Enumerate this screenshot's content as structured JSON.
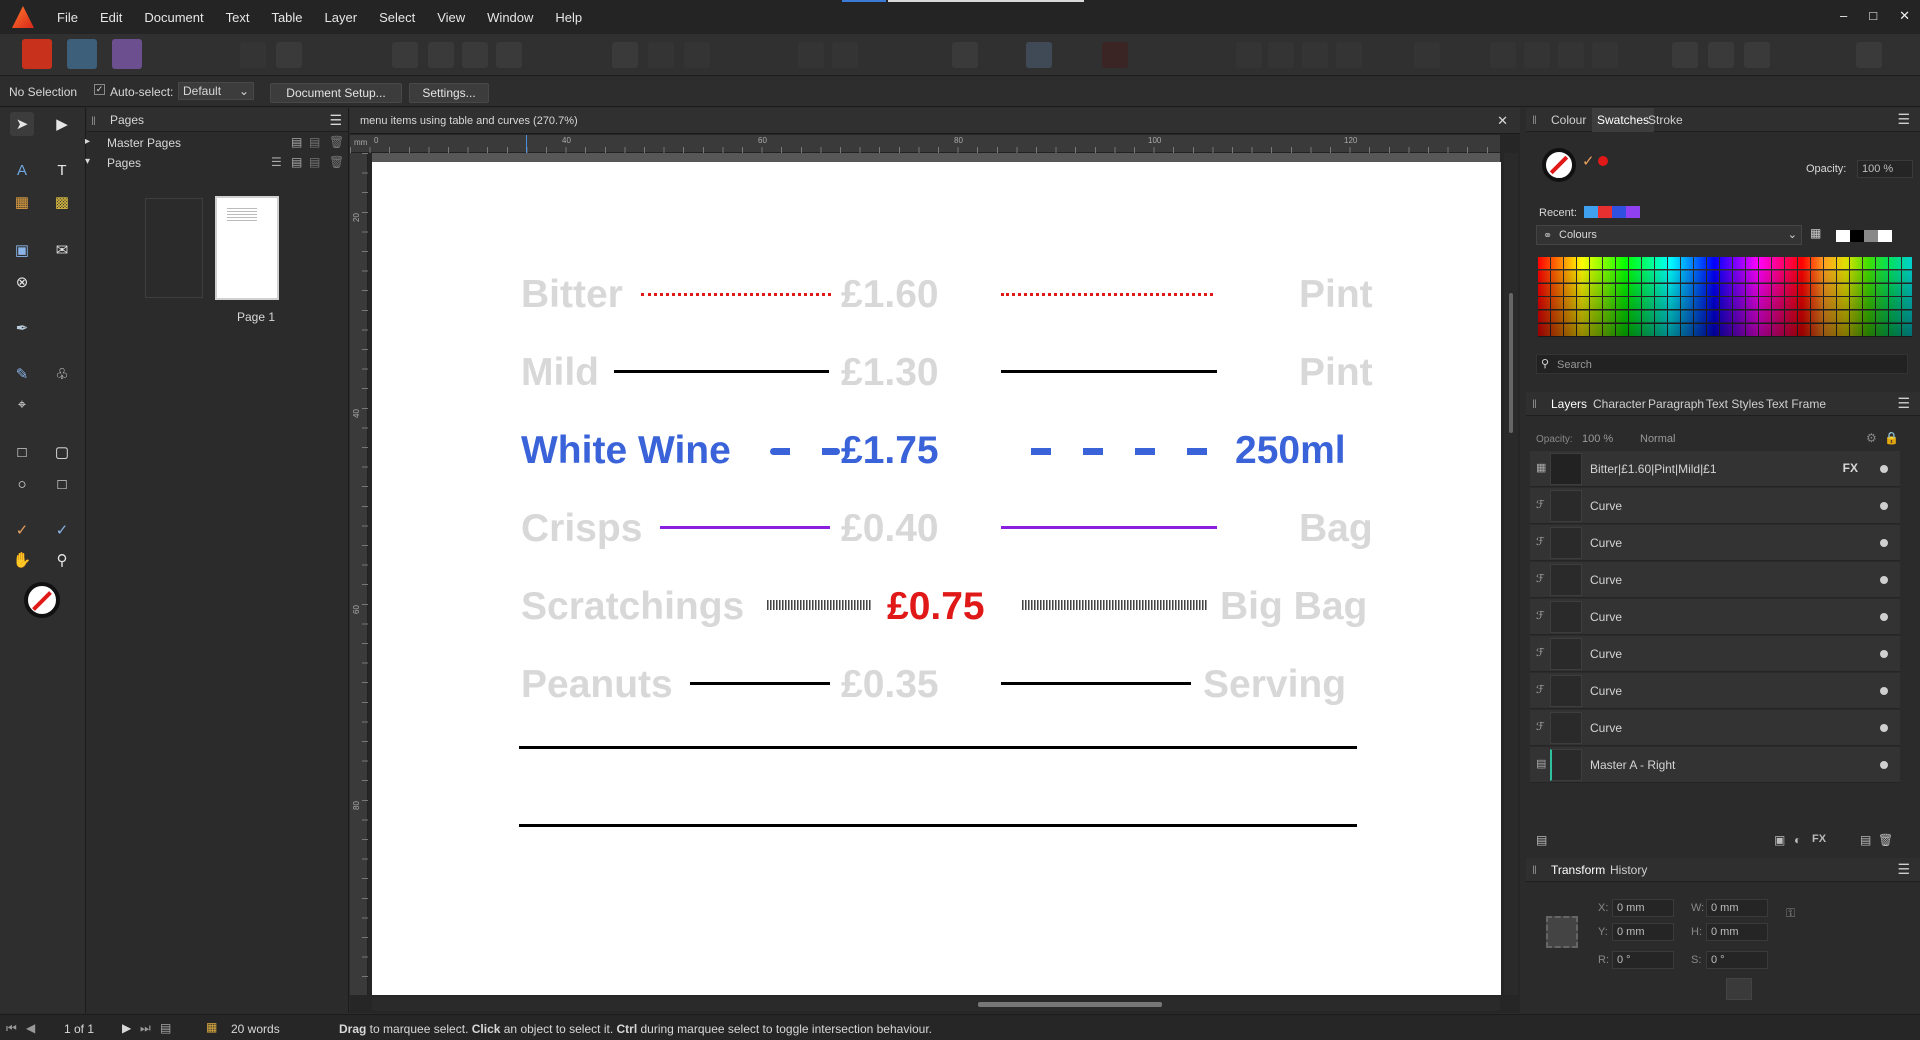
{
  "menu": [
    "File",
    "Edit",
    "Document",
    "Text",
    "Table",
    "Layer",
    "Select",
    "View",
    "Window",
    "Help"
  ],
  "window_buttons": [
    "–",
    "□",
    "✕"
  ],
  "context": {
    "selection": "No Selection",
    "autoselect_label": "Auto-select:",
    "autoselect_value": "Default",
    "doc_setup": "Document Setup...",
    "settings": "Settings..."
  },
  "pages_panel": {
    "title": "Pages",
    "master_pages": "Master Pages",
    "pages": "Pages",
    "page_label": "Page 1"
  },
  "document": {
    "tab_title": "menu items using table and curves (270.7%)",
    "ruler_unit": "mm",
    "ruler_ticks": [
      "0",
      "40",
      "60",
      "80",
      "100",
      "120"
    ],
    "vruler_ticks": [
      "20",
      "40",
      "60",
      "80"
    ],
    "menu_items": [
      {
        "item": "Bitter",
        "price": "£1.60",
        "unit": "Pint",
        "color": "#000000",
        "price_color": "#000000",
        "line": "red-dotted"
      },
      {
        "item": "Mild",
        "price": "£1.30",
        "unit": "Pint",
        "color": "#000000",
        "price_color": "#000000",
        "line": "black-solid"
      },
      {
        "item": "White Wine",
        "price": "£1.75",
        "unit": "250ml",
        "color": "#3a63d9",
        "price_color": "#3a63d9",
        "line": "blue-dash"
      },
      {
        "item": "Crisps",
        "price": "£0.40",
        "unit": "Bag",
        "color": "#000000",
        "price_color": "#000000",
        "line": "purple-solid"
      },
      {
        "item": "Scratchings",
        "price": "£0.75",
        "unit": "Big Bag",
        "color": "#000000",
        "price_color": "#e01818",
        "line": "rough"
      },
      {
        "item": "Peanuts",
        "price": "£0.35",
        "unit": "Serving",
        "color": "#000000",
        "price_color": "#000000",
        "line": "black-solid"
      }
    ]
  },
  "colour_panel": {
    "tabs": [
      "Colour",
      "Swatches",
      "Stroke"
    ],
    "opacity_label": "Opacity:",
    "opacity_value": "100 %",
    "recent_label": "Recent:",
    "palette_name": "Colours",
    "search_placeholder": "Search"
  },
  "layers_panel": {
    "tabs": [
      "Layers",
      "Character",
      "Paragraph",
      "Text Styles",
      "Text Frame"
    ],
    "opacity_label": "Opacity:",
    "opacity_value": "100 %",
    "blend": "Normal",
    "layers": [
      {
        "name": "Bitter|£1.60|Pint|Mild|£1",
        "fx": "FX"
      },
      {
        "name": "Curve"
      },
      {
        "name": "Curve"
      },
      {
        "name": "Curve"
      },
      {
        "name": "Curve"
      },
      {
        "name": "Curve"
      },
      {
        "name": "Curve"
      },
      {
        "name": "Curve"
      },
      {
        "name": "Master A - Right"
      }
    ]
  },
  "transform_panel": {
    "tabs": [
      "Transform",
      "History"
    ],
    "x_label": "X:",
    "x": "0 mm",
    "y_label": "Y:",
    "y": "0 mm",
    "w_label": "W:",
    "w": "0 mm",
    "h_label": "H:",
    "h": "0 mm",
    "r_label": "R:",
    "r": "0 °",
    "s_label": "S:",
    "s": "0 °"
  },
  "status": {
    "page_count": "1 of 1",
    "words": "20 words",
    "hint_drag": "Drag",
    "hint_drag_text": " to marquee select. ",
    "hint_click": "Click",
    "hint_click_text": " an object to select it. ",
    "hint_ctrl": "Ctrl",
    "hint_ctrl_text": " during marquee select to toggle intersection behaviour."
  }
}
